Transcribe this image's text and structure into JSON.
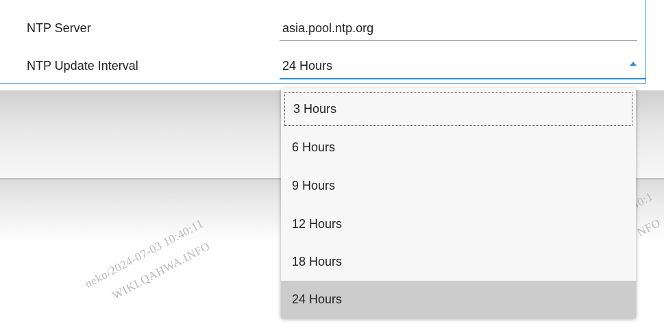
{
  "settings": {
    "ntp_server_label": "NTP Server",
    "ntp_server_value": "asia.pool.ntp.org",
    "ntp_interval_label": "NTP Update Interval",
    "ntp_interval_value": "24 Hours"
  },
  "dropdown": {
    "options": [
      "3 Hours",
      "6 Hours",
      "9 Hours",
      "12 Hours",
      "18 Hours",
      "24 Hours"
    ],
    "selected": "24 Hours",
    "focused": "3 Hours"
  },
  "watermark": {
    "line1": "neko/2024-07-03 10:40:11",
    "line2": "WIKI.QAHWA.INFO",
    "partial1": "40:1",
    "partial2": "NFO"
  },
  "colors": {
    "accent": "#2b8fd9",
    "selected_bg": "#cccccc"
  }
}
